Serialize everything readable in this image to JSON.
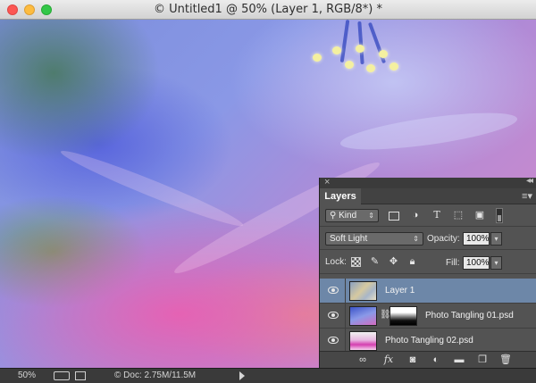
{
  "window": {
    "title": "© Untitled1 @ 50% (Layer 1, RGB/8*) *"
  },
  "status_bar": {
    "zoom": "50%",
    "doc_info": "Doc: 2.75M/11.5M"
  },
  "layers_panel": {
    "close_glyph": "×",
    "collapse_glyph": "◂◂",
    "tab_label": "Layers",
    "filter": {
      "kind_label": "Kind",
      "type_text_glyph": "T"
    },
    "blend_mode": "Soft Light",
    "opacity_label": "Opacity:",
    "opacity_value": "100%",
    "lock_label": "Lock:",
    "fill_label": "Fill:",
    "fill_value": "100%",
    "layers": [
      {
        "name": "Layer 1",
        "selected": true
      },
      {
        "name": "Photo Tangling 01.psd",
        "selected": false,
        "has_mask": true
      },
      {
        "name": "Photo Tangling 02.psd",
        "selected": false
      }
    ],
    "bottom_icons": [
      "link-icon",
      "fx-icon",
      "mask-icon",
      "adjustment-icon",
      "folder-icon",
      "new-layer-icon",
      "trash-icon"
    ],
    "fx_label": "fx"
  },
  "colors": {
    "selected_layer": "#6d87a8",
    "panel_bg": "#535353"
  }
}
